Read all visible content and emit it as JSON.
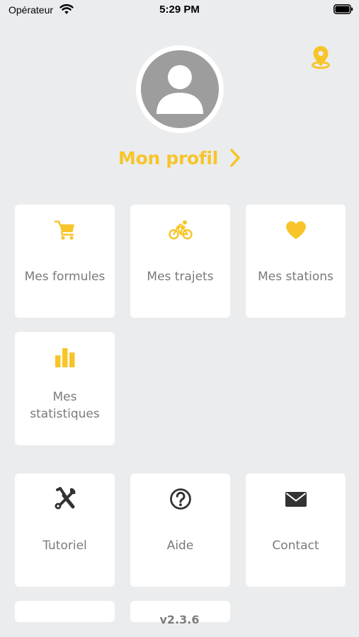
{
  "status_bar": {
    "carrier": "Opérateur",
    "time": "5:29 PM"
  },
  "profile": {
    "label": "Mon profil"
  },
  "tiles": [
    {
      "label": "Mes formules",
      "icon": "cart-icon"
    },
    {
      "label": "Mes trajets",
      "icon": "bicycle-icon"
    },
    {
      "label": "Mes stations",
      "icon": "heart-icon"
    },
    {
      "label_line1": "Mes",
      "label_line2": "statistiques",
      "icon": "bar-chart-icon"
    }
  ],
  "support_tiles": [
    {
      "label": "Tutoriel",
      "icon": "tools-icon"
    },
    {
      "label": "Aide",
      "icon": "help-icon"
    },
    {
      "label": "Contact",
      "icon": "mail-icon"
    }
  ],
  "version": "v2.3.6",
  "colors": {
    "accent": "#f7c52a",
    "background": "#ebecee",
    "tile": "#ffffff",
    "label": "#7a7a7a",
    "dark_icon": "#333333"
  }
}
